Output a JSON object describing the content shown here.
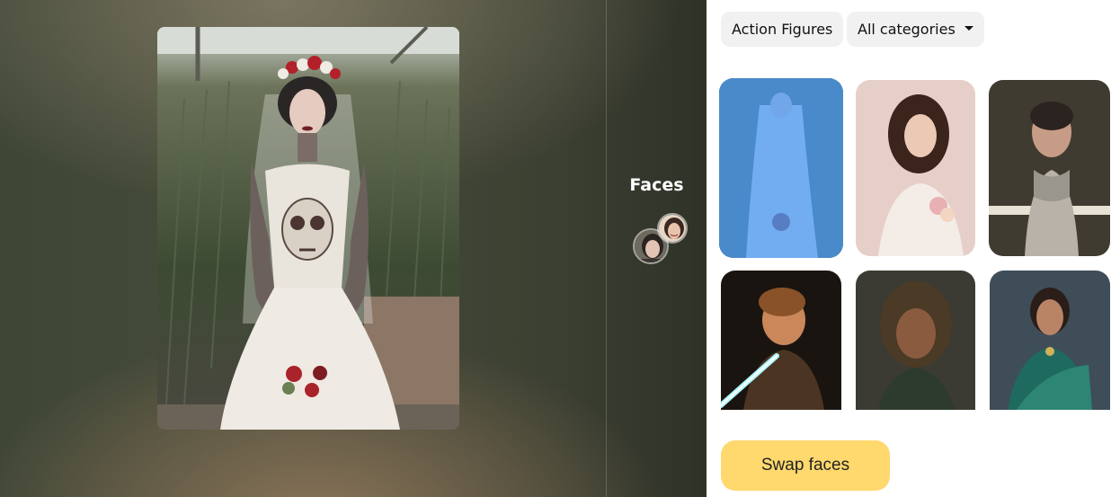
{
  "top_label": "......",
  "faces": {
    "title": "Faces",
    "thumbs": [
      {
        "icon": "face-thumbnail-woman-dark-hair"
      },
      {
        "icon": "face-thumbnail-woman-smiling"
      }
    ]
  },
  "filters": {
    "category_chip": "Action Figures",
    "dropdown": "All categories"
  },
  "gallery": {
    "items": [
      {
        "name": "bride-tattoo",
        "selected": true
      },
      {
        "name": "woman-bouquet"
      },
      {
        "name": "man-scarf"
      },
      {
        "name": "jedi-lightsaber"
      },
      {
        "name": "woman-dreadlocks"
      },
      {
        "name": "woman-saree"
      }
    ]
  },
  "actions": {
    "swap": "Swap faces"
  },
  "colors": {
    "accent_button": "#ffd86e",
    "selection": "#4a9eff"
  }
}
